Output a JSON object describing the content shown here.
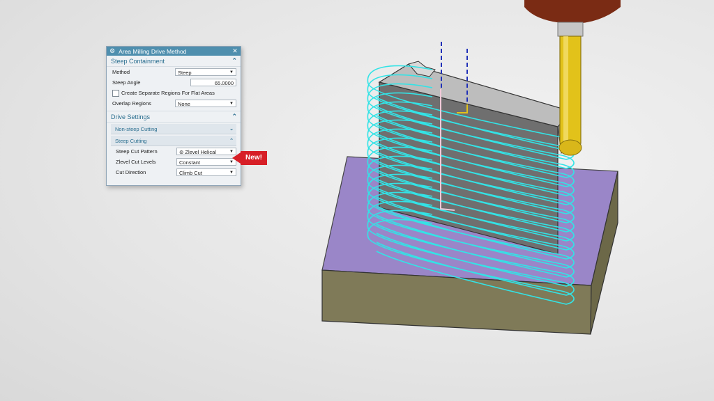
{
  "dialog": {
    "title": "Area Milling Drive Method",
    "steep_containment": {
      "header": "Steep Containment",
      "method_label": "Method",
      "method_value": "Steep",
      "steep_angle_label": "Steep Angle",
      "steep_angle_value": "65.0000",
      "create_regions_label": "Create Separate Regions For Flat Areas",
      "overlap_label": "Overlap Regions",
      "overlap_value": "None"
    },
    "drive_settings": {
      "header": "Drive Settings",
      "non_steep_label": "Non-steep Cutting",
      "steep_label": "Steep Cutting",
      "pattern_label": "Steep Cut Pattern",
      "pattern_value": "Zlevel Helical",
      "zlevel_label": "Zlevel Cut Levels",
      "zlevel_value": "Constant",
      "direction_label": "Cut Direction",
      "direction_value": "Climb Cut"
    }
  },
  "callout": {
    "text": "New!"
  },
  "colors": {
    "title_bar": "#4f8fae",
    "callout": "#d71f27",
    "toolpath": "#33e3e6",
    "base_top": "#9a86c8",
    "base_side": "#7f7a58",
    "tool": "#e2c21a",
    "spindle": "#7a2b14"
  },
  "icons": [
    "gear-icon",
    "close-icon",
    "chevron-up-icon",
    "chevron-down-icon",
    "dropdown-arrow-icon",
    "helical-pattern-icon"
  ]
}
